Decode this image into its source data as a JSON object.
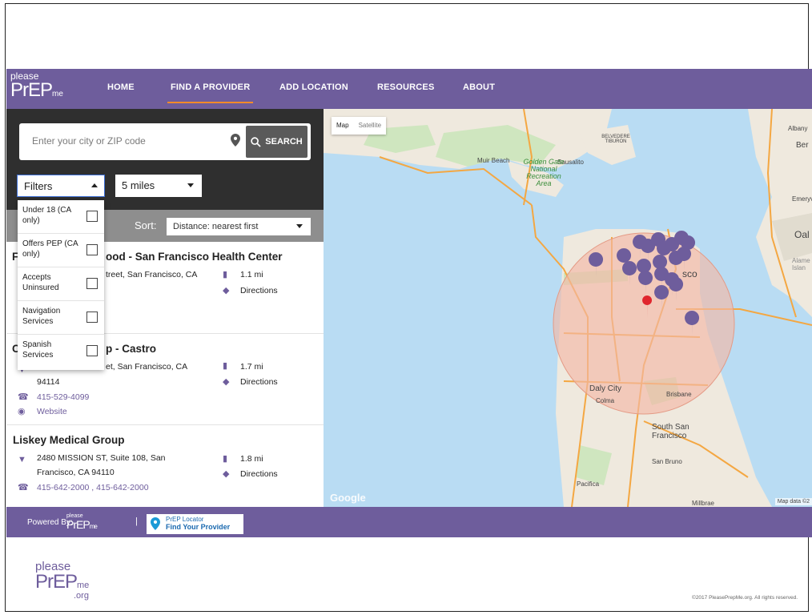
{
  "nav": {
    "logo": {
      "line1": "please",
      "line2": "PrEP",
      "line3": "me"
    },
    "items": [
      "HOME",
      "FIND A PROVIDER",
      "ADD LOCATION",
      "RESOURCES",
      "ABOUT"
    ],
    "active": "FIND A PROVIDER"
  },
  "search": {
    "placeholder": "Enter your city or ZIP code",
    "button_label": "SEARCH"
  },
  "filters": {
    "label": "Filters",
    "options": [
      {
        "label": "Under 18 (CA only)",
        "checked": false
      },
      {
        "label": "Offers PEP (CA only)",
        "checked": false
      },
      {
        "label": "Accepts Uninsured",
        "checked": false
      },
      {
        "label": "Navigation Services",
        "checked": false
      },
      {
        "label": "Spanish Services",
        "checked": false
      }
    ]
  },
  "radius": {
    "selected": "5 miles"
  },
  "sort": {
    "label": "Sort:",
    "selected": "Distance: nearest first"
  },
  "results": [
    {
      "title_visible": "ood - San Francisco Health Center",
      "title_prefix": "F",
      "address_visible": "treet, San Francisco, CA",
      "distance": "1.1 mi",
      "directions": "Directions"
    },
    {
      "title_visible": "p - Castro",
      "title_prefix": "C",
      "address_visible": "et, San Francisco, CA",
      "address_line2": "94114",
      "phone": "415-529-4099",
      "website": "Website",
      "distance": "1.7 mi",
      "directions": "Directions"
    },
    {
      "title": "Liskey Medical Group",
      "address_line1": "2480 MISSION ST, Suite 108, San",
      "address_line2": "Francisco, CA 94110",
      "phone": "415-642-2000 , 415-642-2000",
      "distance": "1.8 mi",
      "directions": "Directions"
    }
  ],
  "map": {
    "type_options": [
      "Map",
      "Satellite"
    ],
    "labels": [
      "Muir Beach",
      "Sausalito",
      "Golden Gate National Recreation Area",
      "BELVEDERE TIBURON",
      "Albany",
      "Ber",
      "Emeryv",
      "Oal",
      "Alame Islan",
      "sco",
      "Daly City",
      "Colma",
      "Brisbane",
      "South San Francisco",
      "San Bruno",
      "Pacifica",
      "Millbrae"
    ],
    "google_mark": "Google",
    "credits": "Map data ©2",
    "colors": {
      "water": "#b9dcf3",
      "land": "#efe9de",
      "park": "#cfe6bf",
      "road": "#f4a742",
      "radius": "#f2b8a6"
    }
  },
  "footer": {
    "powered_by": "Powered By:",
    "small_logo": {
      "line1": "please",
      "line2": "PrEP",
      "line3": "me"
    },
    "separator": "|",
    "locator_line1": "PrEP Locator",
    "locator_line2": "Find Your Provider"
  },
  "bottom_logo": {
    "line1": "please",
    "line2": "PrEP",
    "line3": "me",
    "line4": ".org"
  },
  "copyright": "©2017 PleasePrepMe.org. All rights reserved.",
  "colors": {
    "brand_purple": "#6e5d9c",
    "accent_orange": "#f48a2a",
    "dark_panel": "#2f2f2f"
  }
}
